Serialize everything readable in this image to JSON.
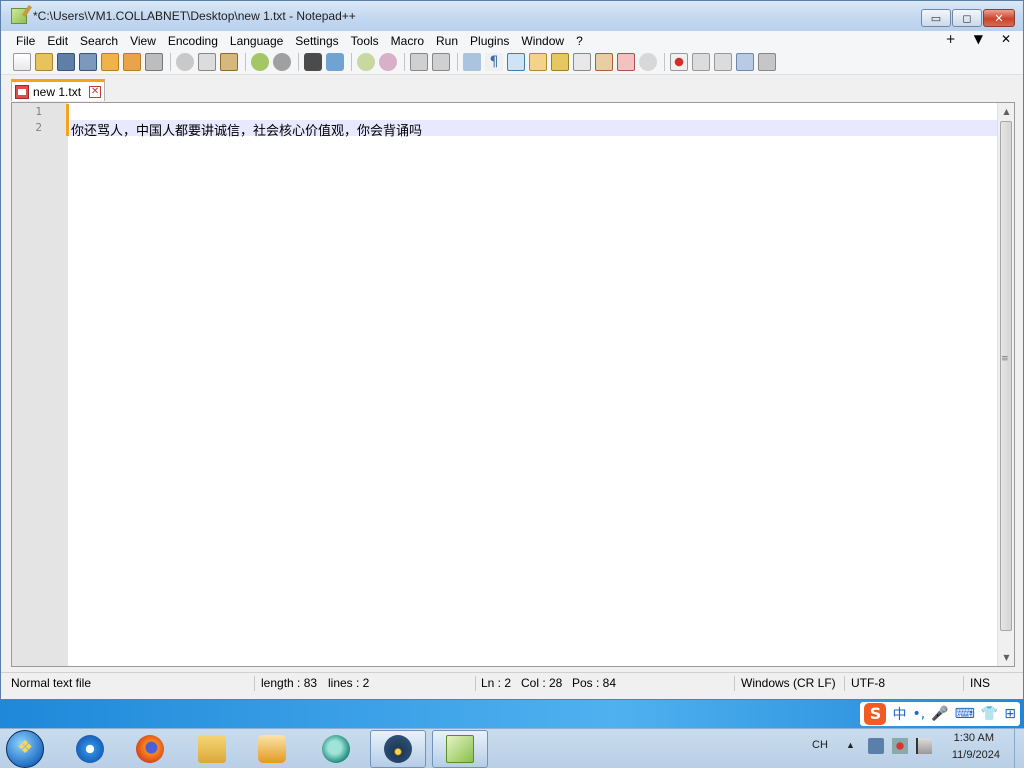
{
  "window": {
    "title": "*C:\\Users\\VM1.COLLABNET\\Desktop\\new 1.txt - Notepad++",
    "controls": {
      "minimize": "▭",
      "maximize": "◻",
      "close": "✕"
    }
  },
  "menubar": {
    "items": [
      "File",
      "Edit",
      "Search",
      "View",
      "Encoding",
      "Language",
      "Settings",
      "Tools",
      "Macro",
      "Run",
      "Plugins",
      "Window",
      "?"
    ],
    "right": [
      "+",
      "▼",
      "✕"
    ]
  },
  "toolbar": {
    "icons": [
      "new-file-icon",
      "open-file-icon",
      "save-icon",
      "save-all-icon",
      "close-icon",
      "close-all-icon",
      "print-icon",
      "cut-icon",
      "copy-icon",
      "paste-icon",
      "undo-icon",
      "redo-icon",
      "find-icon",
      "replace-icon",
      "zoom-in-icon",
      "zoom-out-icon",
      "sync-vertical-icon",
      "sync-horizontal-icon",
      "word-wrap-icon",
      "show-all-chars-icon",
      "indent-guide-icon",
      "user-language-icon",
      "document-map-icon",
      "function-list-icon",
      "folder-as-workspace-icon",
      "monitoring-icon",
      "record-macro-icon",
      "stop-record-icon",
      "playback-icon",
      "run-macro-multiple-icon",
      "save-macro-icon"
    ]
  },
  "tab": {
    "label": "new 1.txt",
    "close": "✕"
  },
  "editor": {
    "line_numbers": [
      "1",
      "2"
    ],
    "lines": [
      "",
      "你还骂人，中国人都要讲诚信，社会核心价值观，你会背诵吗"
    ]
  },
  "statusbar": {
    "file_type": "Normal text file",
    "length": "length : 83",
    "lines": "lines : 2",
    "ln": "Ln : 2",
    "col": "Col : 28",
    "pos": "Pos : 84",
    "eol": "Windows (CR LF)",
    "encoding": "UTF-8",
    "mode": "INS"
  },
  "ime": {
    "logo": "S",
    "items": [
      "中",
      "•,",
      "🎤",
      "⌨",
      "👕",
      "⊞"
    ]
  },
  "taskbar": {
    "apps": [
      "internet-explorer-icon",
      "firefox-icon",
      "file-explorer-icon",
      "media-player-icon",
      "app-round-icon",
      "robot-app-icon",
      "notepadpp-icon"
    ],
    "lang": "CH",
    "time": "1:30 AM",
    "date": "11/9/2024"
  }
}
